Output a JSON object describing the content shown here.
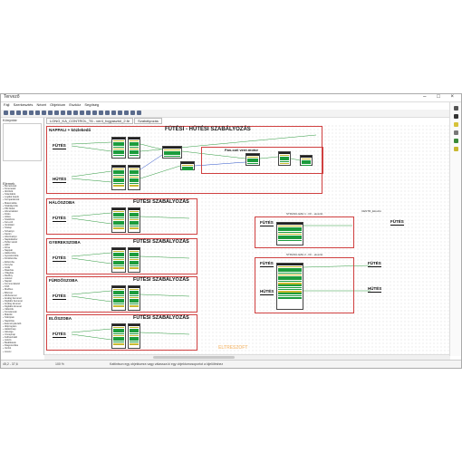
{
  "window": {
    "title": "Tervező",
    "tab_label": "Szabályozás",
    "path_text": "LONG_KA_CONTROL_T6 - ver4_fogyasztói_2.fe",
    "min": "–",
    "max": "□",
    "close": "×"
  },
  "menu": [
    "Fájl",
    "Szerkesztés",
    "Nézet",
    "Objektum",
    "Eszköz",
    "Segítség"
  ],
  "left_panel": {
    "top_header": "Könyvtár",
    "tree_header": "Elemek",
    "tree_items": [
      "Bemenetek",
      "Kimenetek",
      "Időzítők",
      "Számlálók",
      "Logikai kapuk",
      "Komparátorok",
      "Matematika",
      "Szabályozók",
      "PID blokk",
      "Hőmérséklet",
      "Fűtés",
      "Hűtés",
      "Szellőzés",
      "Fan-coil",
      "Ventilátor",
      "Szelep",
      "Szivattyú",
      "Kazán",
      "Hőszivattyú",
      "Napkollektor",
      "Puffer tároló",
      "HMV",
      "Zóna",
      "Nappali",
      "Hálószoba",
      "Gyerekszoba",
      "Fürdőszoba",
      "Előszoba",
      "Konyha",
      "Iroda",
      "Riasztás",
      "Világítás",
      "Redőny",
      "Jelenet",
      "Naptár",
      "Kommunikáció",
      "KNX",
      "Modbus",
      "BACnet",
      "Webszerver",
      "Analóg bemenet",
      "Digitális bemenet",
      "Analóg kimenet",
      "Digitális kimenet",
      "Változók",
      "Konstansok",
      "Makrók",
      "Szkriptek",
      "Naplózás",
      "Eseménykezelő",
      "Időprogram",
      "Hétköznap",
      "Hétvége",
      "Ünnepnap",
      "Felhasználó",
      "Jelszó",
      "Beállítások",
      "Diagnosztika",
      "Verzió",
      "Licenc"
    ]
  },
  "groups": {
    "nappali": {
      "name": "NAPPALI + közlekedő",
      "title": "FÜTÉSI - HÜTÉSI  SZABÁLYOZÁS",
      "label_heat": "FÜTÉS",
      "label_cool": "HÜTÉS",
      "fancoil": "Fan-coil vent.motor"
    },
    "haloszoba": {
      "name": "HÁLÓSZOBA",
      "title": "FÜTÉSI   SZABÁLYOZÁS",
      "label_heat": "FÜTÉS"
    },
    "gyerekszoba": {
      "name": "GYEREKSZOBA",
      "title": "FÜTÉSI   SZABÁLYOZÁS",
      "label_heat": "FÜTÉS"
    },
    "furdoszoba": {
      "name": "FÜRDŐSZOBA",
      "title": "FÜTÉSI   SZABÁLYOZÁS",
      "label_heat": "FÜTÉS"
    },
    "eloszoba": {
      "name": "ELŐSZOBA",
      "title": "FÜTÉSI   SZABÁLYOZÁS",
      "label_heat": "FÜTÉS"
    },
    "right1": {
      "caption": "STRANG  EZH 1 - FF  - elosztó",
      "label_in": "FÜTÉS",
      "label_out": "FÜTÉS",
      "status": "CENTR_Elosztó"
    },
    "right2": {
      "caption": "STRANG  EZH 2 - FF  - elosztó",
      "label_heat_in": "FÜTÉS",
      "label_cool_in": "HÜTÉS",
      "label_heat_out": "FÜTÉS",
      "label_cool_out": "HÜTÉS"
    }
  },
  "status": {
    "coords": "45,2 - 37,6",
    "zoom": "100 %",
    "message": "Kattintson egy objektumra vagy válassza ki egy objektumcsoportot a kijelöléshez"
  },
  "watermark": "ELTRESZOFT",
  "colors": {
    "group_border": "#d04040",
    "wire_green": "#2e9a3e",
    "wire_blue": "#2a50c8",
    "pin_green": "#1c9c3c"
  }
}
